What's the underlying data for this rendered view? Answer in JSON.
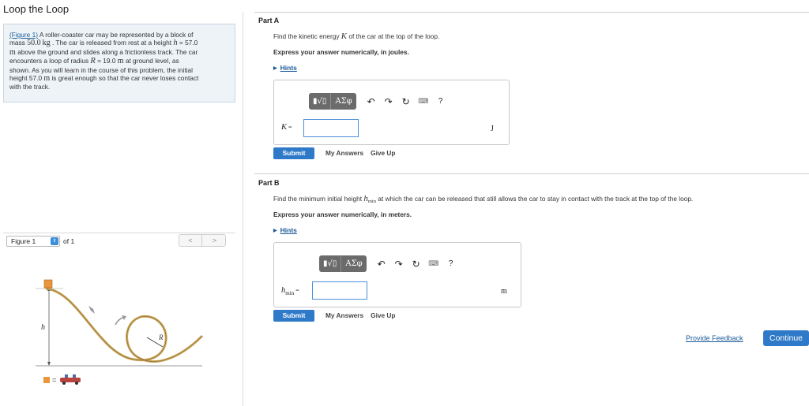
{
  "page": {
    "title": "Loop the Loop"
  },
  "problem": {
    "figure_link": "(Figure 1)",
    "line1": " A roller-coaster car may be represented by a block of",
    "line2_a": "mass ",
    "mass_value": "50.0",
    "mass_unit": "kg",
    "line2_b": " . The car is released from rest at a height ",
    "h_symbol": "h",
    "line2_c": " = 57.0",
    "line3_unit": "m",
    "line3": " above the ground and slides along a frictionless track. The car",
    "line4_a": "encounters a loop of radius ",
    "r_symbol": "R",
    "line4_b": " = 19.0 ",
    "line4_unit": "m",
    "line4_c": " at ground level, as",
    "line5": "shown. As you will learn in the course of this problem, the initial",
    "line6_a": "height 57.0 ",
    "line6_unit": "m",
    "line6_b": " is great enough so that the car never loses contact",
    "line7": "with the track."
  },
  "figure_nav": {
    "select_value": "Figure 1",
    "of_text": "of 1",
    "prev": "<",
    "next": ">"
  },
  "figure": {
    "h_label": "h",
    "r_label": "R",
    "legend_eq": "="
  },
  "toolbar": {
    "templates": "▮√▯",
    "greek": "ΑΣφ",
    "undo": "↶",
    "redo": "↷",
    "reset": "↻",
    "keyboard": "⌨",
    "help": "?"
  },
  "part_a": {
    "title": "Part A",
    "q_before": "Find the kinetic energy ",
    "q_symbol": "K",
    "q_after": " of the car at the top of the loop.",
    "express": "Express your answer numerically, in joules.",
    "hints": "Hints",
    "label_symbol": "K",
    "label_eq": " =",
    "input_value": "",
    "unit": "J",
    "submit": "Submit",
    "my_answers": "My Answers",
    "give_up": "Give Up"
  },
  "part_b": {
    "title": "Part B",
    "q_before": "Find the minimum initial height ",
    "q_symbol": "h",
    "q_sub": "min",
    "q_after": " at which the car can be released that still allows the car to stay in contact with the track at the top of the loop.",
    "express": "Express your answer numerically, in meters.",
    "hints": "Hints",
    "label_symbol": "h",
    "label_sub": "min",
    "label_eq": " =",
    "input_value": "",
    "unit": "m",
    "submit": "Submit",
    "my_answers": "My Answers",
    "give_up": "Give Up"
  },
  "footer": {
    "feedback": "Provide Feedback",
    "continue": "Continue"
  },
  "colors": {
    "accent_blue": "#2f7ac8",
    "link_blue": "#1a5a99",
    "panel_bg": "#eef3f8",
    "track": "#c8a55a",
    "block": "#e8963a"
  }
}
